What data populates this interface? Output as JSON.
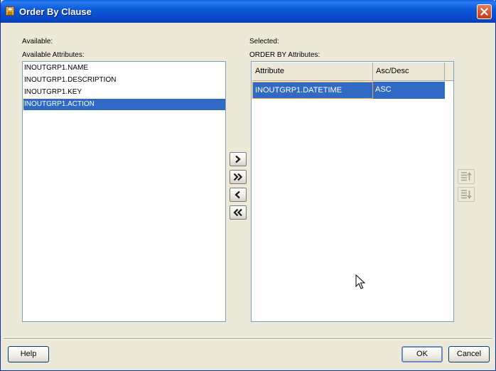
{
  "window": {
    "title": "Order By Clause"
  },
  "available": {
    "group_label": "Available:",
    "list_label": "Available Attributes:",
    "items": [
      {
        "label": "INOUTGRP1.NAME",
        "selected": false
      },
      {
        "label": "INOUTGRP1.DESCRIPTION",
        "selected": false
      },
      {
        "label": "INOUTGRP1.KEY",
        "selected": false
      },
      {
        "label": "INOUTGRP1.ACTION",
        "selected": true
      }
    ]
  },
  "selected": {
    "group_label": "Selected:",
    "list_label": "ORDER BY Attributes:",
    "columns": [
      "Attribute",
      "Asc/Desc"
    ],
    "rows": [
      {
        "attribute": "INOUTGRP1.DATETIME",
        "order": "ASC",
        "selected": true
      }
    ]
  },
  "transfer_buttons": [
    {
      "name": "move-right-button",
      "icon": "chevron-right-icon"
    },
    {
      "name": "move-all-right-button",
      "icon": "double-chevron-right-icon"
    },
    {
      "name": "move-left-button",
      "icon": "chevron-left-icon"
    },
    {
      "name": "move-all-left-button",
      "icon": "double-chevron-left-icon"
    }
  ],
  "order_buttons": [
    {
      "name": "move-up-button",
      "icon": "move-up-icon",
      "enabled": false
    },
    {
      "name": "move-down-button",
      "icon": "move-down-icon",
      "enabled": false
    }
  ],
  "footer": {
    "help_label": "Help",
    "ok_label": "OK",
    "cancel_label": "Cancel"
  },
  "colors": {
    "titlebar": "#0a5fe0",
    "selection": "#316ac5",
    "dialog_bg": "#ece9d8",
    "close_button": "#d8512c"
  }
}
